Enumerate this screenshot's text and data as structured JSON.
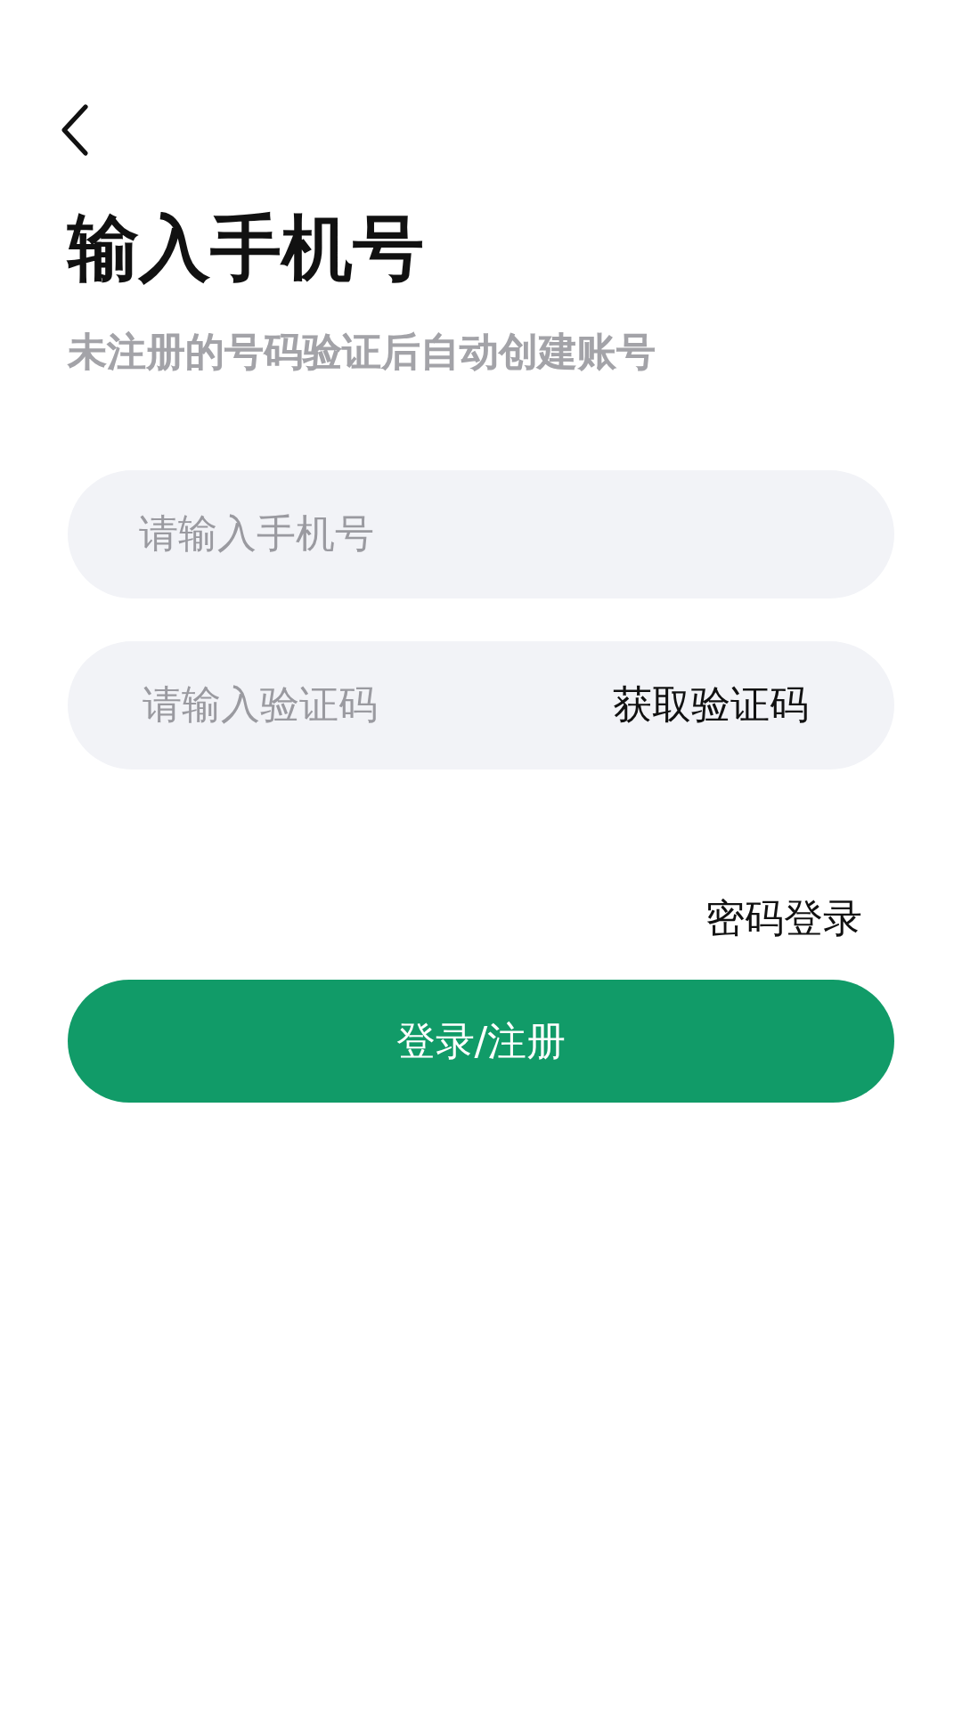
{
  "title": "输入手机号",
  "subtitle": "未注册的号码验证后自动创建账号",
  "phone_field": {
    "placeholder": "请输入手机号"
  },
  "code_field": {
    "placeholder": "请输入验证码",
    "action": "获取验证码"
  },
  "password_login_link": "密码登录",
  "submit_button": "登录/注册"
}
